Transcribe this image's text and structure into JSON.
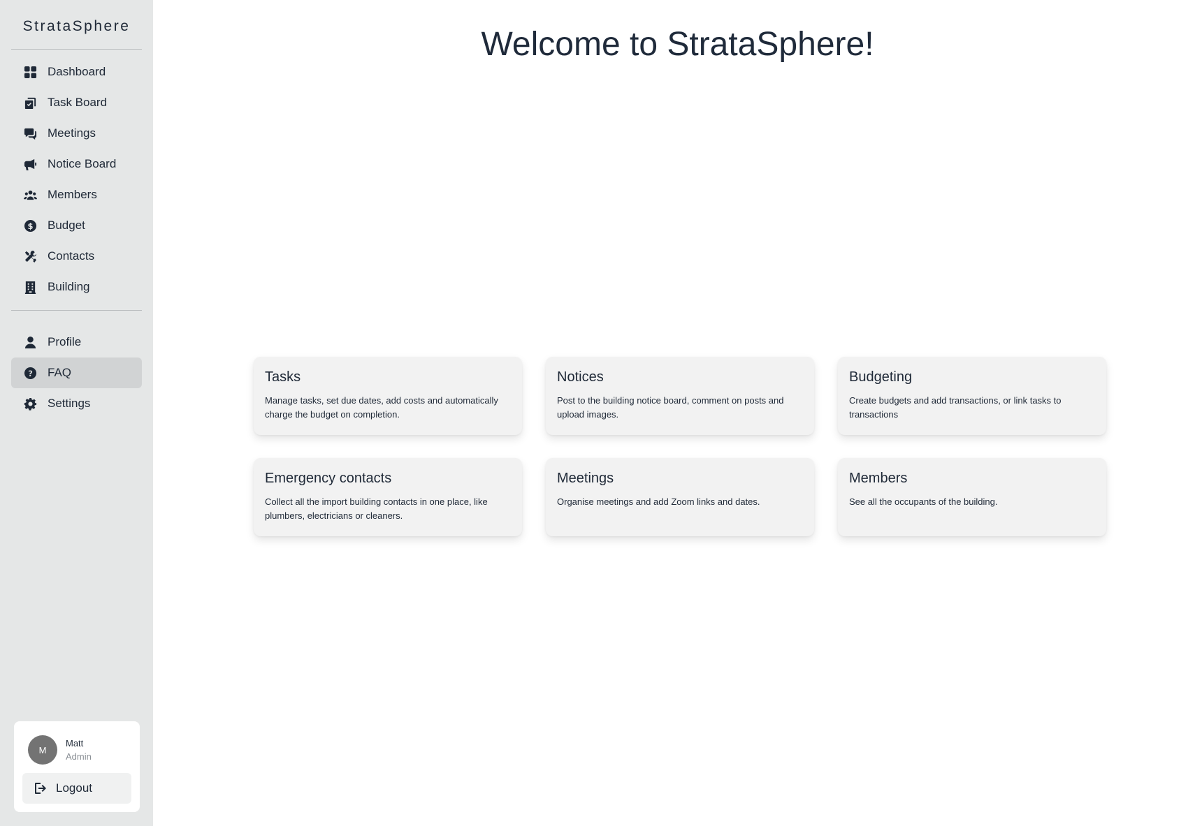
{
  "brand": "StrataSphere",
  "nav": [
    {
      "id": "dashboard",
      "label": "Dashboard",
      "icon": "dashboard-icon"
    },
    {
      "id": "task-board",
      "label": "Task Board",
      "icon": "clipboard-check-icon"
    },
    {
      "id": "meetings",
      "label": "Meetings",
      "icon": "comments-icon"
    },
    {
      "id": "notice-board",
      "label": "Notice Board",
      "icon": "megaphone-icon"
    },
    {
      "id": "members",
      "label": "Members",
      "icon": "users-icon"
    },
    {
      "id": "budget",
      "label": "Budget",
      "icon": "dollar-circle-icon"
    },
    {
      "id": "contacts",
      "label": "Contacts",
      "icon": "tools-icon"
    },
    {
      "id": "building",
      "label": "Building",
      "icon": "building-icon"
    }
  ],
  "nav_secondary": [
    {
      "id": "profile",
      "label": "Profile",
      "icon": "user-icon"
    },
    {
      "id": "faq",
      "label": "FAQ",
      "icon": "question-circle-icon",
      "active": true
    },
    {
      "id": "settings",
      "label": "Settings",
      "icon": "gear-icon"
    }
  ],
  "user": {
    "initial": "M",
    "name": "Matt",
    "role": "Admin",
    "logout_label": "Logout"
  },
  "main": {
    "title": "Welcome to StrataSphere!",
    "cards": [
      {
        "title": "Tasks",
        "desc": "Manage tasks, set due dates, add costs and automatically charge the budget on completion."
      },
      {
        "title": "Notices",
        "desc": "Post to the building notice board, comment on posts and upload images."
      },
      {
        "title": "Budgeting",
        "desc": "Create budgets and add transactions, or link tasks to transactions"
      },
      {
        "title": "Emergency contacts",
        "desc": "Collect all the import building contacts in one place, like plumbers, electricians or cleaners."
      },
      {
        "title": "Meetings",
        "desc": "Organise meetings and add Zoom links and dates."
      },
      {
        "title": "Members",
        "desc": "See all the occupants of the building."
      }
    ]
  },
  "colors": {
    "sidebar_bg": "#e5e7e7",
    "active_bg": "#d1d3d4",
    "card_bg": "#f2f2f2",
    "text": "#1f2937",
    "avatar_bg": "#737373"
  }
}
